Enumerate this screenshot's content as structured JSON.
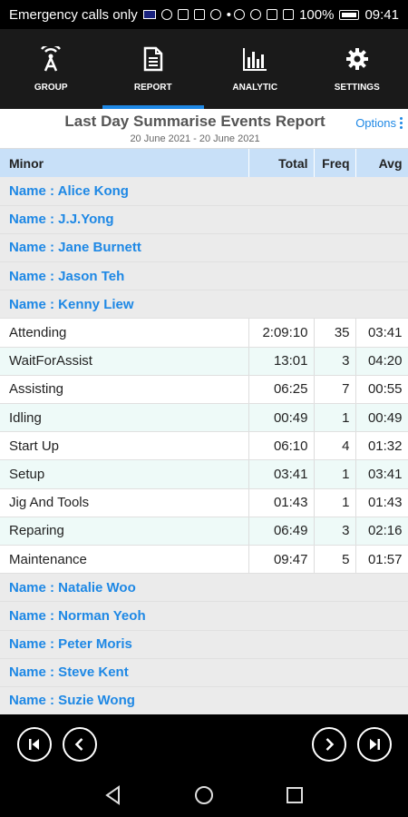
{
  "status_bar": {
    "carrier_text": "Emergency calls only",
    "battery": "100%",
    "time": "09:41"
  },
  "nav": {
    "tabs": [
      {
        "label": "GROUP",
        "icon": "wifi-tower-icon"
      },
      {
        "label": "REPORT",
        "icon": "document-icon"
      },
      {
        "label": "ANALYTIC",
        "icon": "bar-chart-icon"
      },
      {
        "label": "SETTINGS",
        "icon": "gear-icon"
      }
    ],
    "active": "REPORT"
  },
  "report": {
    "title": "Last Day Summarise Events Report",
    "date_range": "20 June 2021 - 20 June 2021",
    "options_label": "Options"
  },
  "table": {
    "headers": {
      "minor": "Minor",
      "total": "Total",
      "freq": "Freq",
      "avg": "Avg"
    },
    "names_before": [
      "Name : Alice Kong",
      "Name : J.J.Yong",
      "Name : Jane Burnett",
      "Name : Jason Teh",
      "Name : Kenny Liew"
    ],
    "events": [
      {
        "minor": "Attending",
        "total": "2:09:10",
        "freq": "35",
        "avg": "03:41"
      },
      {
        "minor": "WaitForAssist",
        "total": "13:01",
        "freq": "3",
        "avg": "04:20"
      },
      {
        "minor": "Assisting",
        "total": "06:25",
        "freq": "7",
        "avg": "00:55"
      },
      {
        "minor": "Idling",
        "total": "00:49",
        "freq": "1",
        "avg": "00:49"
      },
      {
        "minor": "Start Up",
        "total": "06:10",
        "freq": "4",
        "avg": "01:32"
      },
      {
        "minor": "Setup",
        "total": "03:41",
        "freq": "1",
        "avg": "03:41"
      },
      {
        "minor": "Jig And Tools",
        "total": "01:43",
        "freq": "1",
        "avg": "01:43"
      },
      {
        "minor": "Reparing",
        "total": "06:49",
        "freq": "3",
        "avg": "02:16"
      },
      {
        "minor": "Maintenance",
        "total": "09:47",
        "freq": "5",
        "avg": "01:57"
      }
    ],
    "names_after": [
      "Name : Natalie Woo",
      "Name : Norman Yeoh",
      "Name : Peter Moris",
      "Name : Steve Kent",
      "Name : Suzie Wong"
    ]
  },
  "colors": {
    "accent": "#1e88e5",
    "header_bg": "#c8e0f8",
    "name_row_bg": "#ebebeb",
    "alt_row_bg": "#eefaf8"
  }
}
